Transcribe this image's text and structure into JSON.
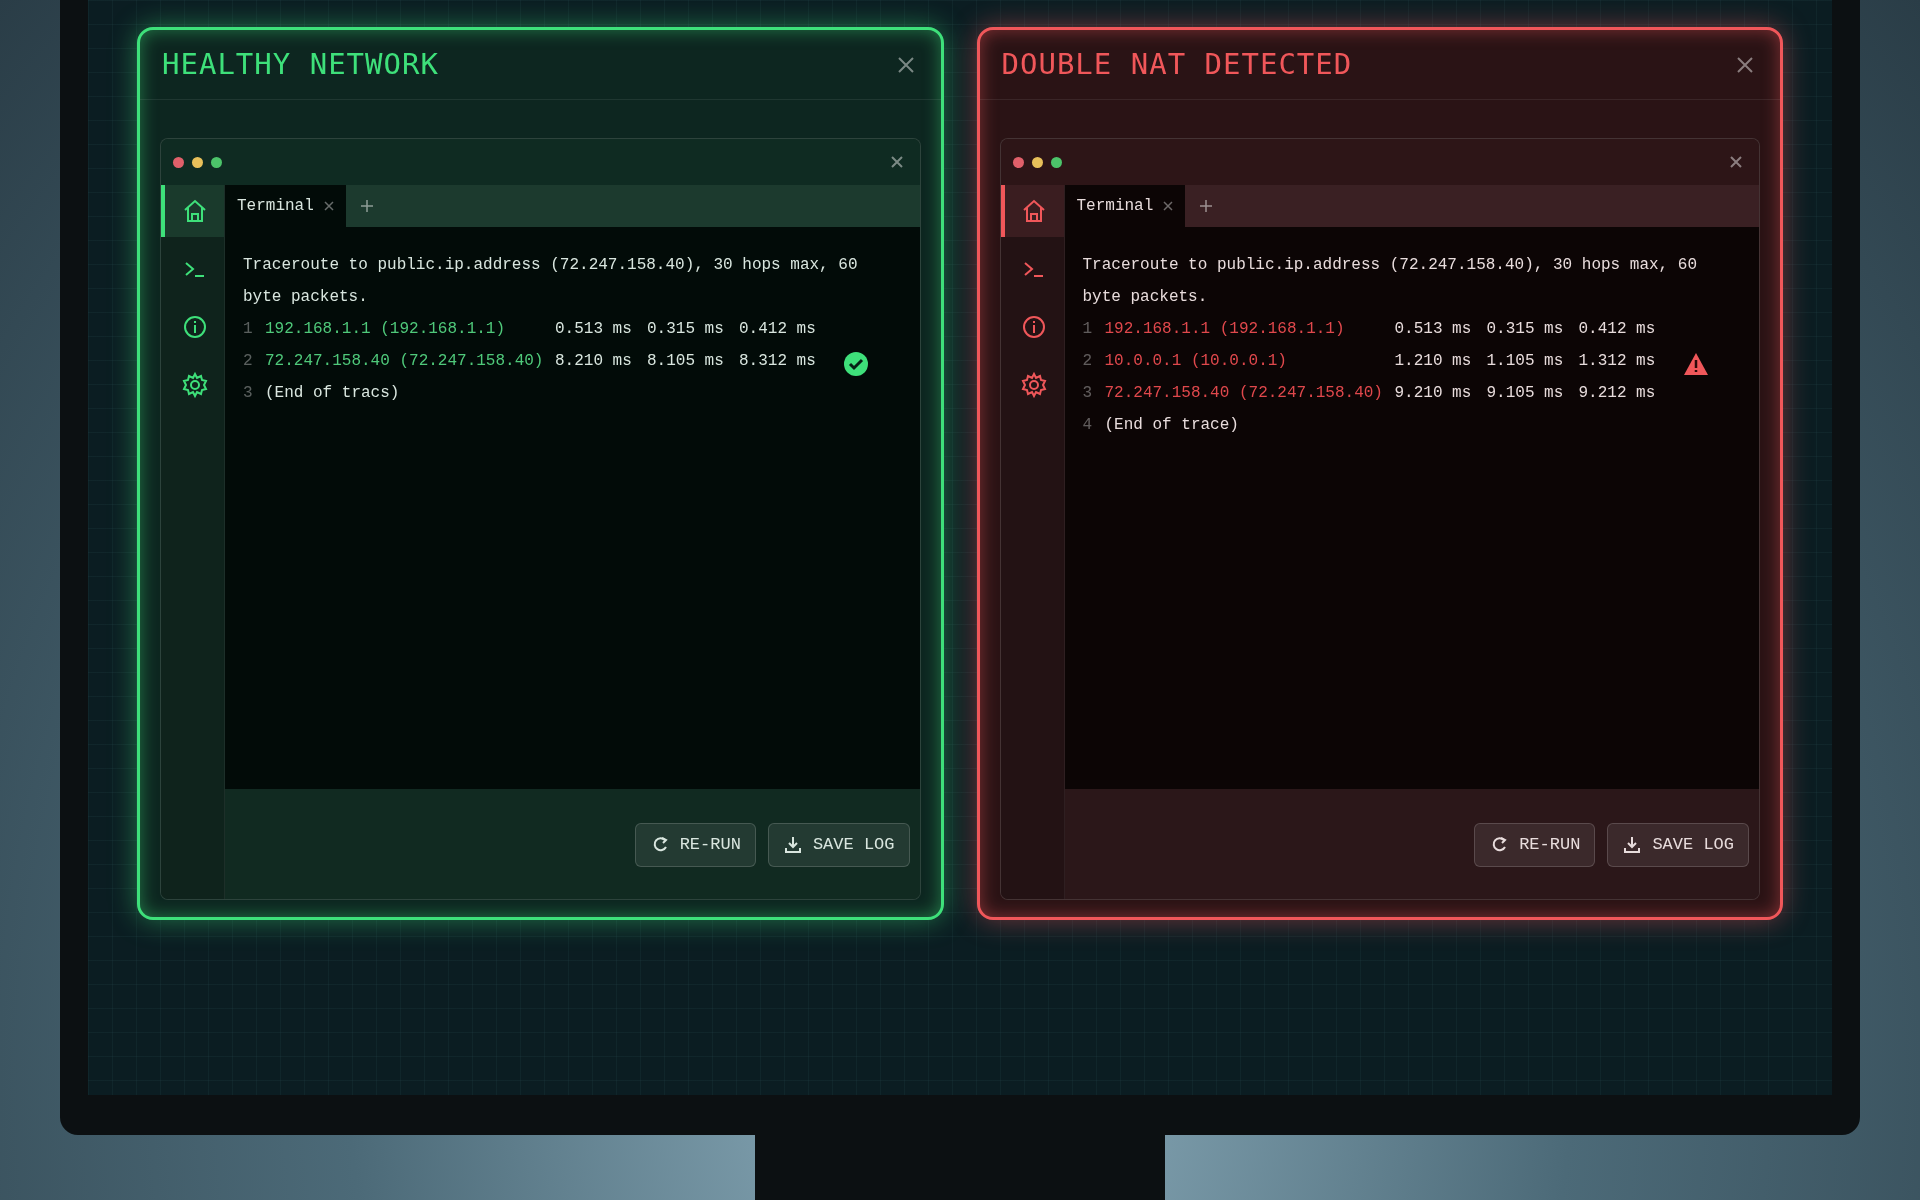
{
  "panels": [
    {
      "title": "HEALTHY NETWORK",
      "color": "#3ee07a",
      "window": {
        "tabs": [
          {
            "label": "Terminal",
            "selected": true
          }
        ],
        "sidebar": [
          {
            "kind": "home",
            "selected": true
          },
          {
            "kind": "terminal",
            "selected": false
          },
          {
            "kind": "info",
            "selected": false
          },
          {
            "kind": "settings",
            "selected": false
          }
        ],
        "header": "Traceroute to public.ip.address (72.247.158.40), 30 hops max, 60 byte packets.",
        "hops": [
          {
            "num": "1",
            "host": "192.168.1.1 (192.168.1.1)",
            "times": [
              "0.513 ms",
              "0.315 ms",
              "0.412 ms"
            ]
          },
          {
            "num": "2",
            "host": "72.247.158.40 (72.247.158.40)",
            "times": [
              "8.210 ms",
              "8.105 ms",
              "8.312 ms"
            ],
            "kind": "hop_ok"
          },
          {
            "num": "3",
            "note": "(End of tracs)"
          }
        ],
        "buttons": [
          {
            "kind": "rerun",
            "label": "RE-RUN"
          },
          {
            "kind": "save",
            "label": "SAVE LOG"
          }
        ]
      }
    },
    {
      "title": "DOUBLE NAT DETECTED",
      "color": "#f0575a",
      "window": {
        "tabs": [
          {
            "label": "Terminal",
            "selected": true
          }
        ],
        "sidebar": [
          {
            "kind": "home",
            "selected": true
          },
          {
            "kind": "terminal",
            "selected": false
          },
          {
            "kind": "info",
            "selected": false
          },
          {
            "kind": "settings",
            "selected": false
          }
        ],
        "header": "Traceroute to public.ip.address (72.247.158.40), 30 hops max, 60 byte packets.",
        "hops": [
          {
            "num": "1",
            "host": "192.168.1.1 (192.168.1.1)",
            "times": [
              "0.513 ms",
              "0.315 ms",
              "0.412 ms"
            ]
          },
          {
            "num": "2",
            "host": "10.0.0.1 (10.0.0.1)",
            "times": [
              "1.210 ms",
              "1.105 ms",
              "1.312 ms"
            ],
            "kind": "hop_warn"
          },
          {
            "num": "3",
            "host": "72.247.158.40 (72.247.158.40)",
            "times": [
              "9.210 ms",
              "9.105 ms",
              "9.212 ms"
            ]
          },
          {
            "num": "4",
            "note": "(End of trace)"
          }
        ],
        "buttons": [
          {
            "kind": "rerun",
            "label": "RE-RUN"
          },
          {
            "kind": "save",
            "label": "SAVE LOG"
          }
        ]
      }
    }
  ]
}
